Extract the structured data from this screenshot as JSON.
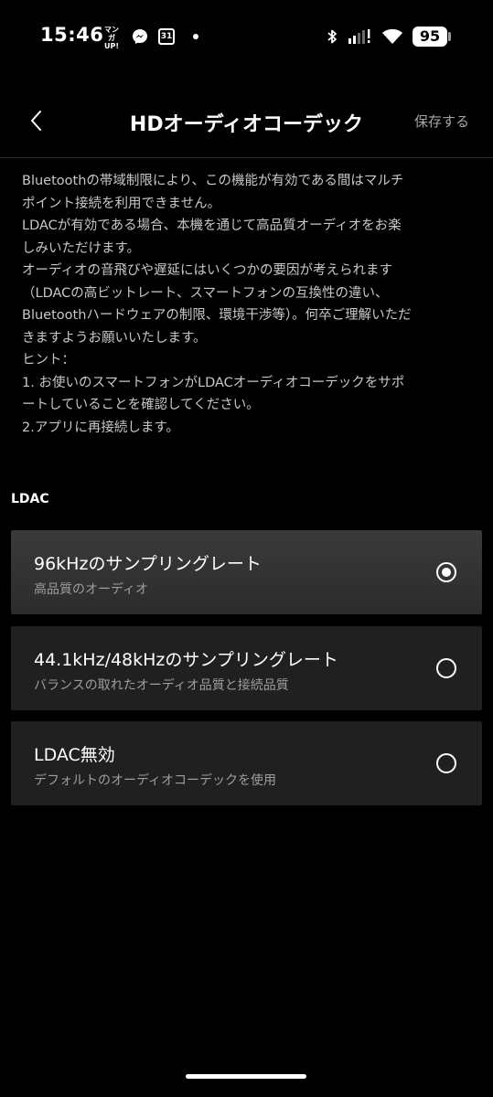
{
  "status_bar": {
    "time": "15:46",
    "manga_icon_text": "マンガ UP!",
    "calendar_day": "31",
    "battery_level": "95",
    "icons": [
      "manga-up-icon",
      "messenger-icon",
      "calendar-icon",
      "notification-dot-icon",
      "bluetooth-icon",
      "signal-icon",
      "wifi-icon",
      "battery-icon"
    ]
  },
  "header": {
    "title": "HDオーディオコーデック",
    "save_label": "保存する",
    "back_icon": "chevron-left-icon"
  },
  "description": {
    "lines": [
      "Bluetoothの帯域制限により、この機能が有効である間はマルチ",
      "ポイント接続を利用できません。",
      "LDACが有効である場合、本機を通じて高品質オーディオをお楽",
      "しみいただけます。",
      "オーディオの音飛びや遅延にはいくつかの要因が考えられます",
      "（LDACの高ビットレート、スマートフォンの互換性の違い、",
      "Bluetoothハードウェアの制限、環境干渉等）。何卒ご理解いただ",
      "きますようお願いいたします。",
      "ヒント：",
      "1. お使いのスマートフォンがLDACオーディオコーデックをサポ",
      "ートしていることを確認してください。",
      "2.アプリに再接続します。"
    ]
  },
  "section": {
    "label": "LDAC"
  },
  "options": [
    {
      "title": "96kHzのサンプリングレート",
      "subtitle": "高品質のオーディオ",
      "selected": true
    },
    {
      "title": "44.1kHz/48kHzのサンプリングレート",
      "subtitle": "バランスの取れたオーディオ品質と接続品質",
      "selected": false
    },
    {
      "title": "LDAC無効",
      "subtitle": "デフォルトのオーディオコーデックを使用",
      "selected": false
    }
  ],
  "colors": {
    "background": "#000000",
    "selected_option_bg": "#353535",
    "option_bg": "#202020",
    "text_primary": "#ffffff",
    "text_secondary": "#9e9e9e",
    "save_text": "#a6a6a6"
  }
}
